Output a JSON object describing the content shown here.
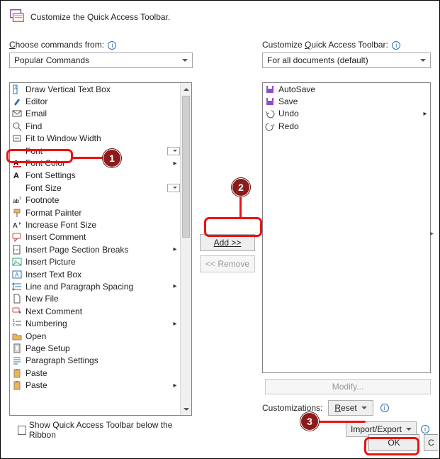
{
  "header": {
    "title": "Customize the Quick Access Toolbar."
  },
  "left": {
    "choose_label_pre": "",
    "choose_letter": "C",
    "choose_label_post": "hoose commands from:",
    "dropdown": "Popular Commands",
    "items": [
      {
        "id": "draw-vertical-text-box",
        "label": "Draw Vertical Text Box"
      },
      {
        "id": "editor",
        "label": "Editor"
      },
      {
        "id": "email",
        "label": "Email"
      },
      {
        "id": "find",
        "label": "Find"
      },
      {
        "id": "fit-to-window-width",
        "label": "Fit to Window Width"
      },
      {
        "id": "font",
        "label": "Font",
        "drop": true
      },
      {
        "id": "font-color",
        "label": "Font Color",
        "flyout": true
      },
      {
        "id": "font-settings",
        "label": "Font Settings"
      },
      {
        "id": "font-size",
        "label": "Font Size",
        "drop": true
      },
      {
        "id": "footnote",
        "label": "Footnote"
      },
      {
        "id": "format-painter",
        "label": "Format Painter"
      },
      {
        "id": "increase-font-size",
        "label": "Increase Font Size"
      },
      {
        "id": "insert-comment",
        "label": "Insert Comment"
      },
      {
        "id": "insert-page-section-breaks",
        "label": "Insert Page  Section Breaks",
        "flyout": true
      },
      {
        "id": "insert-picture",
        "label": "Insert Picture"
      },
      {
        "id": "insert-text-box",
        "label": "Insert Text Box"
      },
      {
        "id": "line-and-paragraph-spacing",
        "label": "Line and Paragraph Spacing",
        "flyout": true
      },
      {
        "id": "new-file",
        "label": "New File"
      },
      {
        "id": "next-comment",
        "label": "Next Comment"
      },
      {
        "id": "numbering",
        "label": "Numbering",
        "flyout": true
      },
      {
        "id": "open",
        "label": "Open"
      },
      {
        "id": "page-setup",
        "label": "Page Setup"
      },
      {
        "id": "paragraph-settings",
        "label": "Paragraph Settings"
      },
      {
        "id": "paste",
        "label": "Paste"
      },
      {
        "id": "paste-1",
        "label": "Paste",
        "flyout": true
      }
    ],
    "show_below_pre": "",
    "show_below_letter": "S",
    "show_below_post": "how Quick Access Toolbar below the Ribbon"
  },
  "mid": {
    "add_label": "Add >>",
    "remove_label": "<< Remove"
  },
  "right": {
    "cust_label_pre": "Customize ",
    "cust_letter": "Q",
    "cust_label_post": "uick Access Toolbar:",
    "dropdown": "For all documents (default)",
    "items": [
      {
        "id": "autosave",
        "label": "AutoSave"
      },
      {
        "id": "save",
        "label": "Save"
      },
      {
        "id": "undo",
        "label": "Undo",
        "flyout": true
      },
      {
        "id": "redo",
        "label": "Redo"
      }
    ],
    "modify_label": "Modify...",
    "customizations_label": "Customizations:",
    "reset_label": "Reset",
    "import_export_label": "Import/Export"
  },
  "footer": {
    "ok": "OK",
    "c": "C"
  },
  "callouts": {
    "one": "1",
    "two": "2",
    "three": "3"
  }
}
